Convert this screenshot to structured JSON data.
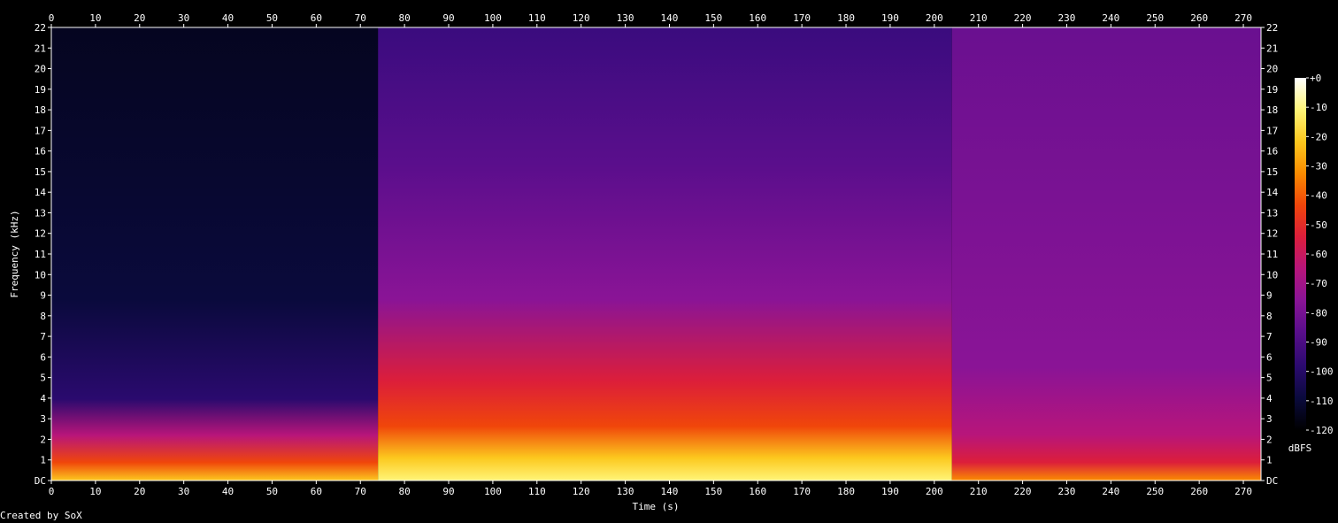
{
  "chart_data": {
    "type": "heatmap",
    "xlabel": "Time (s)",
    "ylabel": "Frequency (kHz)",
    "colorbar_label": "dBFS",
    "xlim": [
      0,
      274
    ],
    "ylim": [
      0,
      22
    ],
    "clim": [
      -120,
      0
    ],
    "x_ticks": [
      "0",
      "10",
      "20",
      "30",
      "40",
      "50",
      "60",
      "70",
      "80",
      "90",
      "100",
      "110",
      "120",
      "130",
      "140",
      "150",
      "160",
      "170",
      "180",
      "190",
      "200",
      "210",
      "220",
      "230",
      "240",
      "250",
      "260",
      "270"
    ],
    "y_ticks": [
      "DC",
      "1",
      "2",
      "3",
      "4",
      "5",
      "6",
      "7",
      "8",
      "9",
      "10",
      "11",
      "12",
      "13",
      "14",
      "15",
      "16",
      "17",
      "18",
      "19",
      "20",
      "21",
      "22"
    ],
    "colorbar_ticks": [
      "+0",
      "-10",
      "-20",
      "-30",
      "-40",
      "-50",
      "-60",
      "-70",
      "-80",
      "-90",
      "-100",
      "-110",
      "-120"
    ],
    "colormap": [
      "#000000",
      "#0a0a3c",
      "#2a0a6e",
      "#5a0e8c",
      "#8a1496",
      "#b8157a",
      "#dc1e3a",
      "#f0460a",
      "#fa8c00",
      "#fcc81e",
      "#fff578",
      "#ffffff"
    ],
    "segments": [
      {
        "t_start": 0,
        "t_end": 74,
        "level": "quiet intro, energy below 4 kHz"
      },
      {
        "t_start": 74,
        "t_end": 204,
        "level": "full band loud section"
      },
      {
        "t_start": 204,
        "t_end": 274,
        "level": "fade-out, mostly below 2 kHz"
      }
    ]
  },
  "footer_text": "Created by SoX"
}
